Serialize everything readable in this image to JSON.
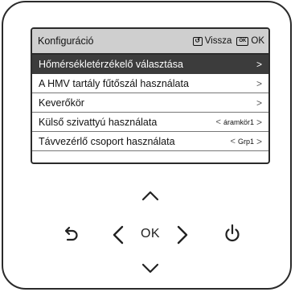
{
  "header": {
    "title": "Konfiguráció",
    "back_key": "↺",
    "back_label": "Vissza",
    "ok_key": "OK",
    "ok_label": "OK"
  },
  "menu": {
    "items": [
      {
        "label": "Hőmérsékletérzékelő választása",
        "value": "",
        "selected": true
      },
      {
        "label": "A HMV tartály fűtőszál használata",
        "value": "",
        "selected": false
      },
      {
        "label": "Keverőkör",
        "value": "",
        "selected": false
      },
      {
        "label": "Külső szivattyú használata",
        "value": "áramkör1",
        "selected": false
      },
      {
        "label": "Távvezérlő csoport használata",
        "value": "Grp1",
        "selected": false
      }
    ]
  },
  "keypad": {
    "ok_label": "OK",
    "icons": [
      "chevron-up-icon",
      "back-icon",
      "chevron-left-icon",
      "chevron-right-icon",
      "power-icon",
      "chevron-down-icon"
    ]
  }
}
